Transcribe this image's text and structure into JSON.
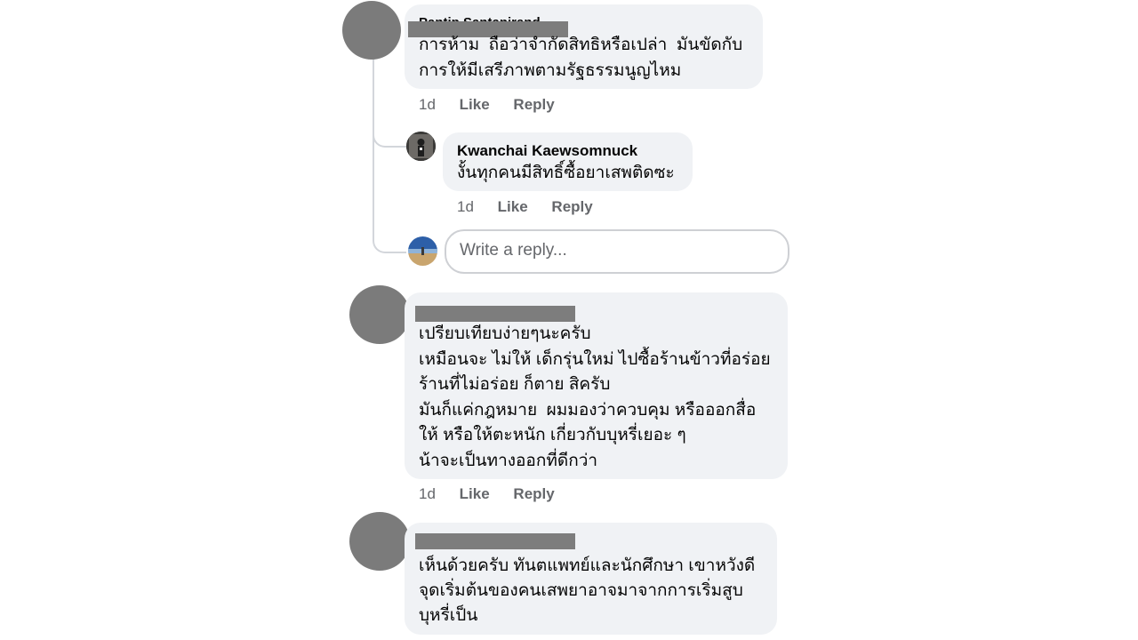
{
  "comments": [
    {
      "author": "Pantip Santanirand",
      "lines": [
        "การห้าม  ถือว่าจำกัดสิทธิหรือเปล่า  มันขัดกับ",
        "การให้มีเสรีภาพตามรัฐธรรมนูญไหม"
      ],
      "time": "1d",
      "like": "Like",
      "reply": "Reply"
    },
    {
      "author": "Kwanchai Kaewsomnuck",
      "lines": [
        "งั้นทุกคนมีสิทธิ์ซื้อยาเสพติดซะ"
      ],
      "time": "1d",
      "like": "Like",
      "reply": "Reply"
    },
    {
      "lines": [
        "เปรียบเทียบง่ายๆนะครับ",
        "เหมือนจะ ไม่ให้ เด็กรุ่นใหม่ ไปซื้อร้านข้าวที่อร่อย",
        "ร้านที่ไม่อร่อย ก็ตาย สิครับ",
        "มันก็แค่กฎหมาย  ผมมองว่าควบคุม หรือออกสื่อ",
        "ให้ หรือให้ตะหนัก เกี่ยวกับบุหรี่เยอะ ๆ",
        "น้าจะเป็นทางออกที่ดีกว่า"
      ],
      "time": "1d",
      "like": "Like",
      "reply": "Reply"
    },
    {
      "lines": [
        "เห็นด้วยครับ ทันตแพทย์และนักศึกษา เขาหวังดี",
        "จุดเริ่มต้นของคนเสพยาอาจมาจากการเริ่มสูบ",
        "บุหรี่เป็น"
      ]
    }
  ],
  "reply_box": {
    "placeholder": "Write a reply..."
  },
  "colors": {
    "bubble": "#f0f2f5",
    "meta_text": "#65676b",
    "redaction": "#7d7d7d"
  }
}
